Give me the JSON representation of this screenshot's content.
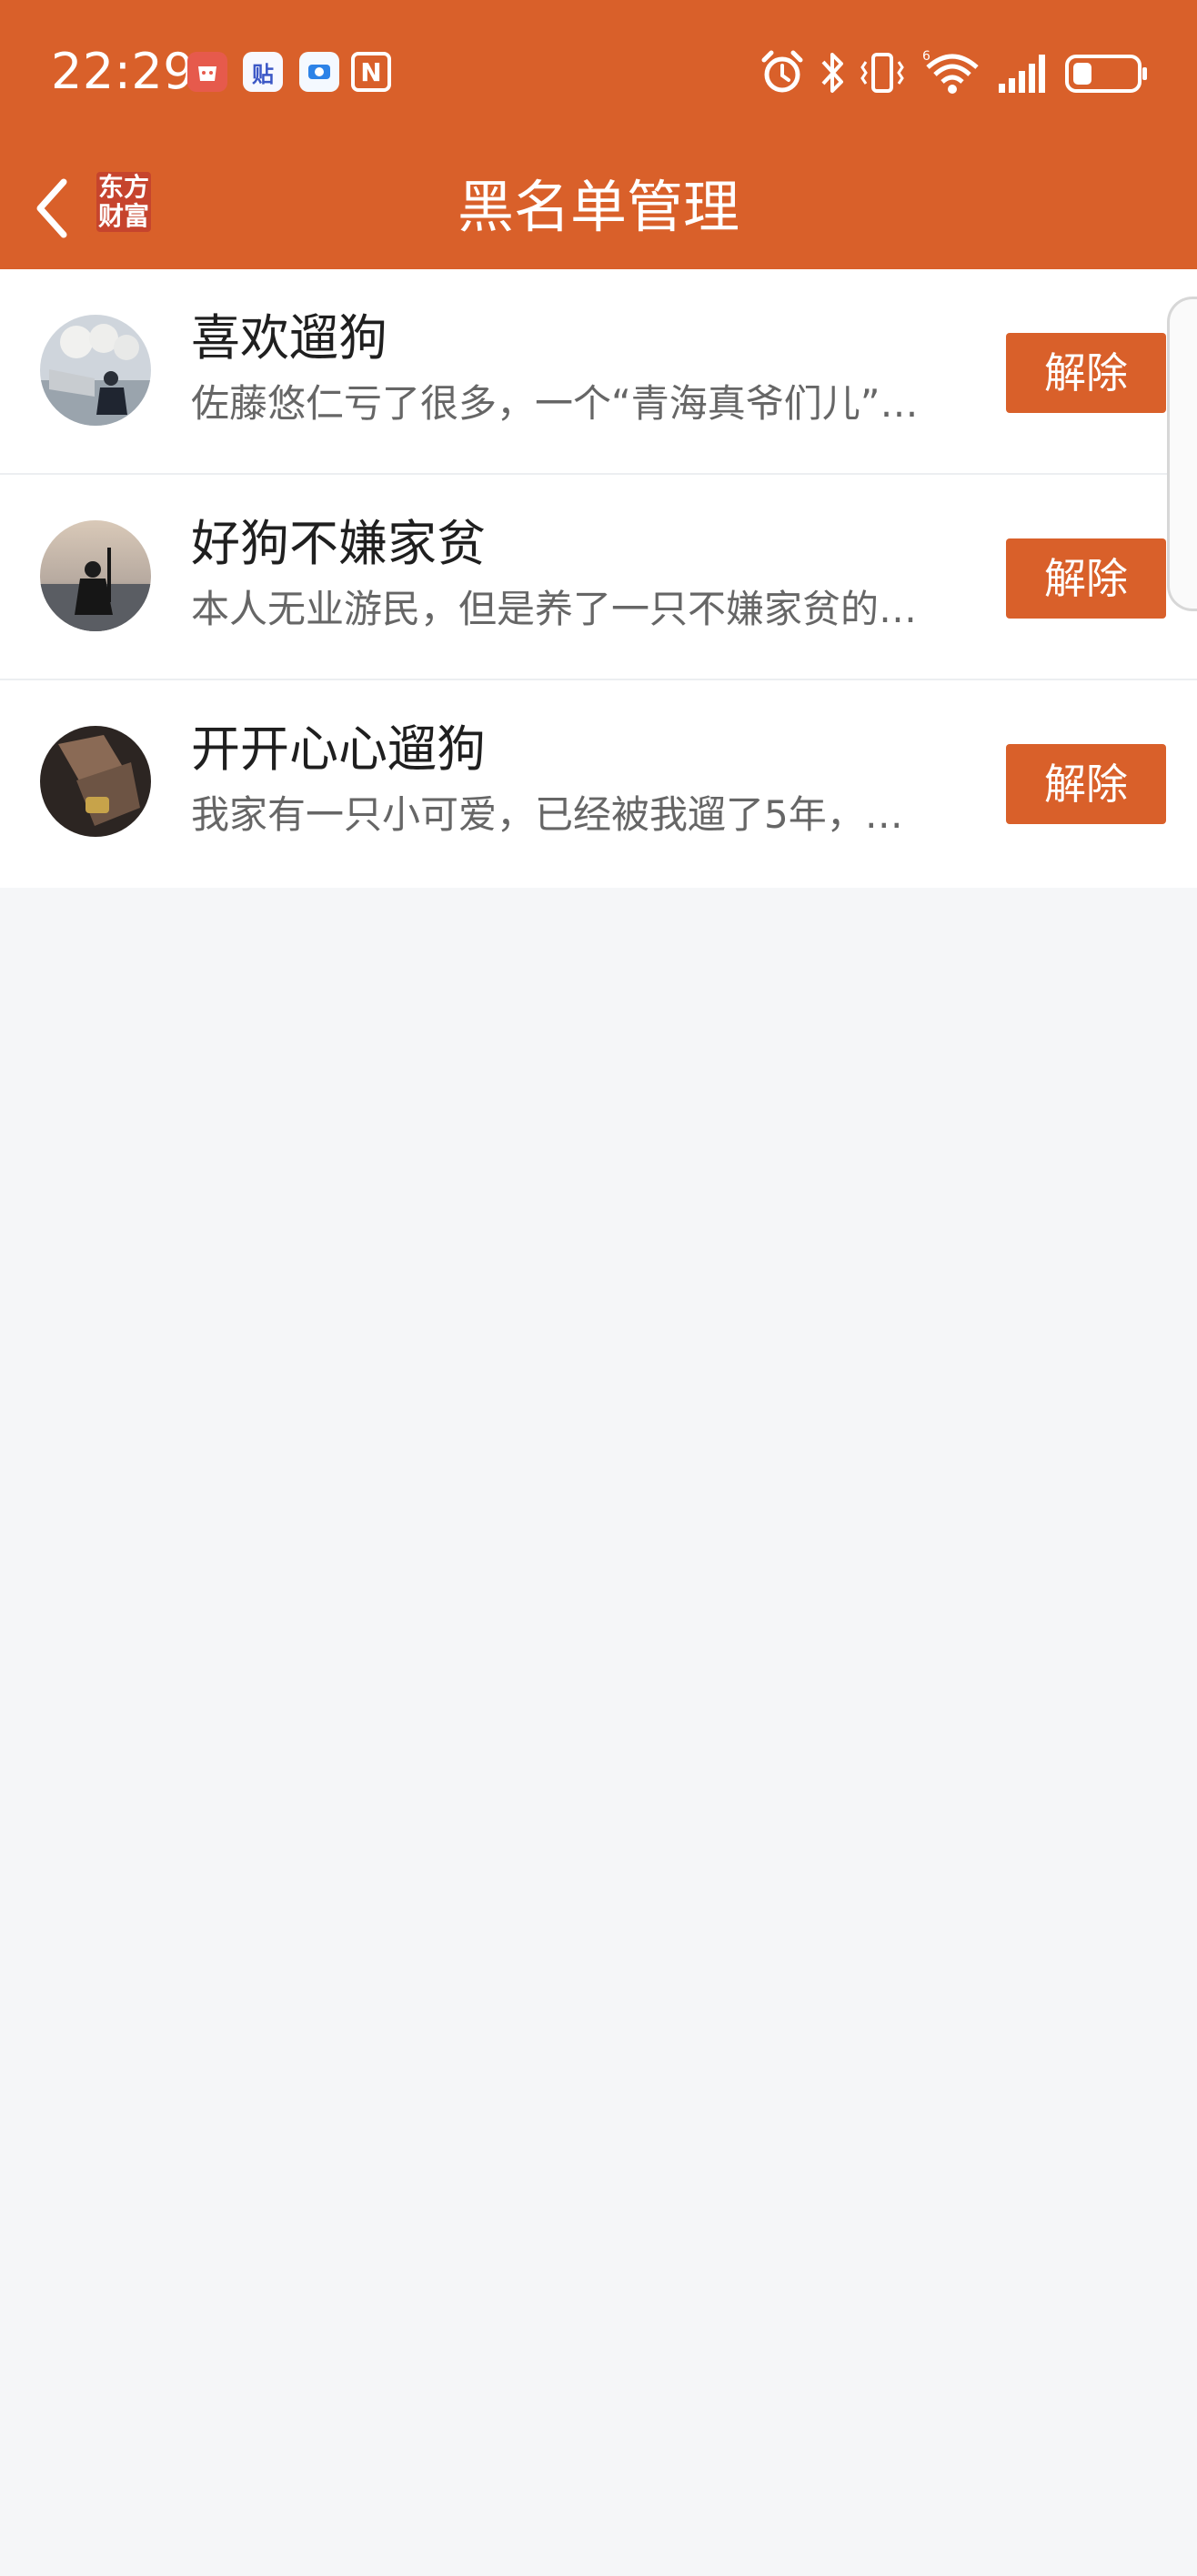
{
  "status_bar": {
    "time": "22:29",
    "notification_icons": [
      "app-notification-icon",
      "tieba-icon",
      "dataflow-icon",
      "nfc-icon"
    ],
    "system_icons": [
      "alarm-icon",
      "bluetooth-icon",
      "vibrate-icon",
      "wifi-6-icon",
      "signal-icon",
      "battery-icon"
    ],
    "battery_level": 0.3,
    "app_icon_labels": {
      "tieba": "贴",
      "nfc": "N"
    }
  },
  "header": {
    "title": "黑名单管理",
    "brand_logo_line1": "东方",
    "brand_logo_line2": "财富",
    "background_color": "#d9602a"
  },
  "blacklist": {
    "items": [
      {
        "name": "喜欢遛狗",
        "description": "佐藤悠仁亏了很多，一个“青海真爷们儿”…",
        "action_label": "解除"
      },
      {
        "name": "好狗不嫌家贫",
        "description": "本人无业游民，但是养了一只不嫌家贫的…",
        "action_label": "解除"
      },
      {
        "name": "开开心心遛狗",
        "description": "我家有一只小可爱，已经被我遛了5年，…",
        "action_label": "解除"
      }
    ]
  },
  "colors": {
    "accent": "#d9602a",
    "page_background": "#f5f6f8",
    "text_primary": "#1f1f1f",
    "text_secondary": "#666666"
  }
}
